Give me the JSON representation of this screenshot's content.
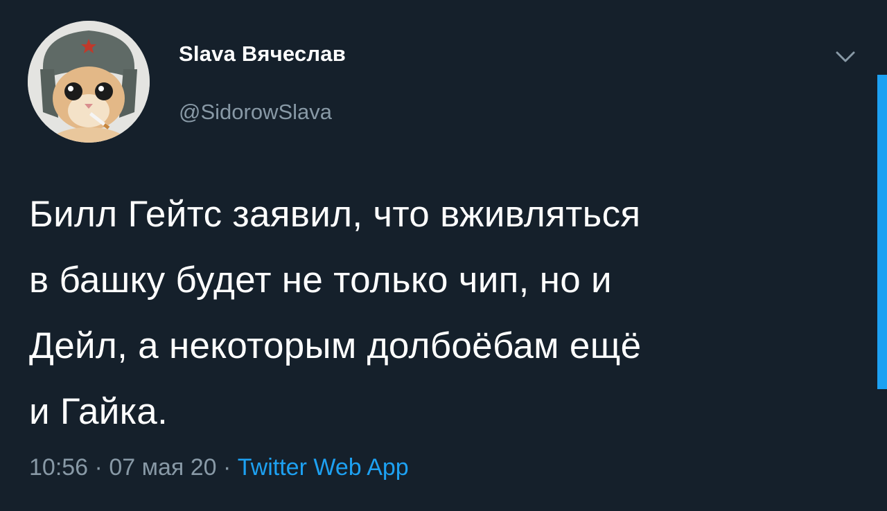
{
  "tweet": {
    "display_name": "Slava Вячеслав",
    "handle": "@SidorowSlava",
    "text": "Билл Гейтс заявил, что вживляться\nв башку будет не только чип, но и\nДейл, а некоторым долбоёбам ещё\nи Гайка.",
    "time": "10:56",
    "separator": " · ",
    "date": "07 мая 20",
    "source_app": "Twitter Web App"
  },
  "icons": {
    "avatar": "cat-in-ushanka-avatar",
    "menu": "chevron-down-icon"
  },
  "colors": {
    "background": "#15202b",
    "primary_text": "#ffffff",
    "secondary_text": "#8899a6",
    "accent": "#1da1f2"
  }
}
